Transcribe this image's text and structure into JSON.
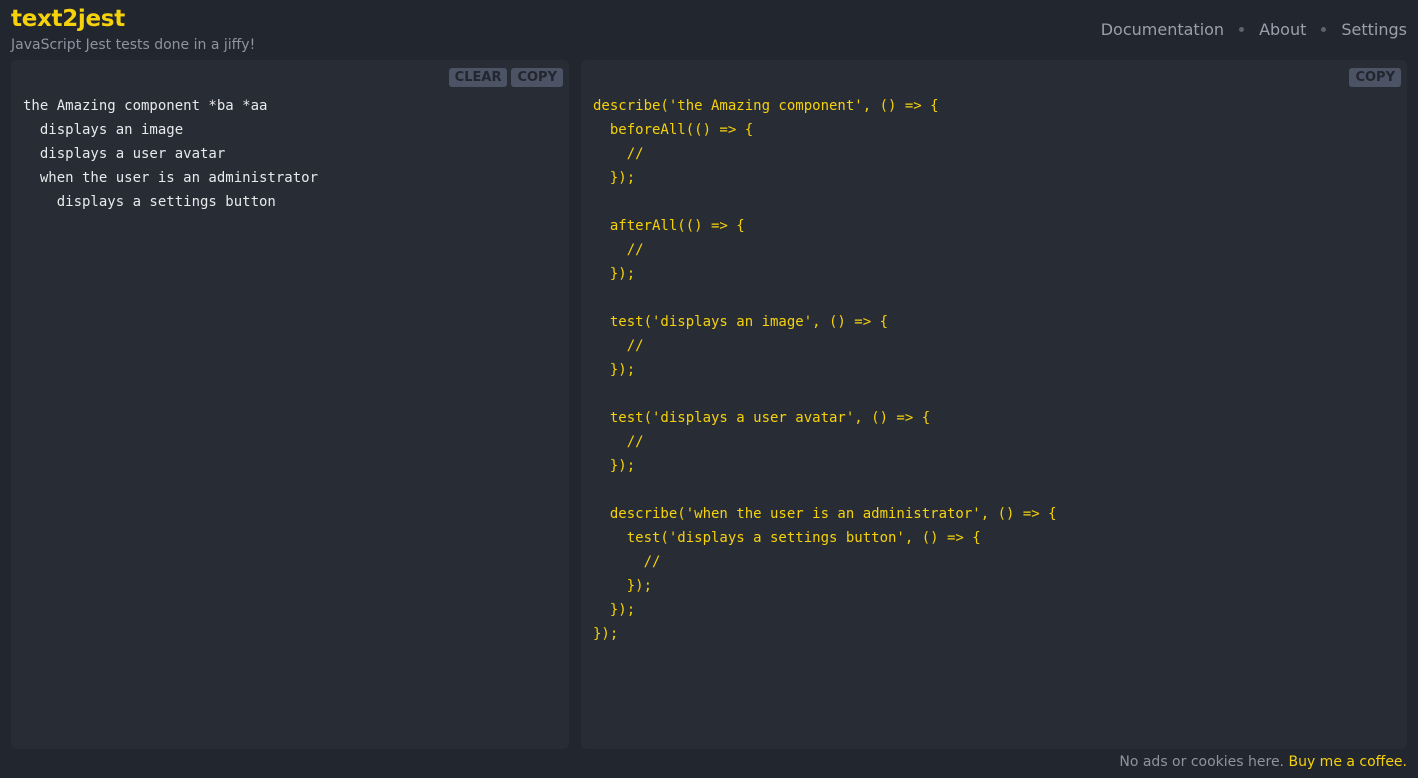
{
  "header": {
    "title": "text2jest",
    "tagline": "JavaScript Jest tests done in a jiffy!",
    "nav": [
      "Documentation",
      "About",
      "Settings"
    ]
  },
  "input_panel": {
    "clear_label": "CLEAR",
    "copy_label": "COPY",
    "text": "the Amazing component *ba *aa\n  displays an image\n  displays a user avatar\n  when the user is an administrator\n    displays a settings button"
  },
  "output_panel": {
    "copy_label": "COPY",
    "code": "describe('the Amazing component', () => {\n  beforeAll(() => {\n    //\n  });\n\n  afterAll(() => {\n    //\n  });\n\n  test('displays an image', () => {\n    //\n  });\n\n  test('displays a user avatar', () => {\n    //\n  });\n\n  describe('when the user is an administrator', () => {\n    test('displays a settings button', () => {\n      //\n    });\n  });\n});"
  },
  "footer": {
    "text": "No ads or cookies here. ",
    "link": "Buy me a coffee."
  },
  "colors": {
    "accent": "#f5d20c",
    "background": "#22262f",
    "panel": "#282c35"
  }
}
